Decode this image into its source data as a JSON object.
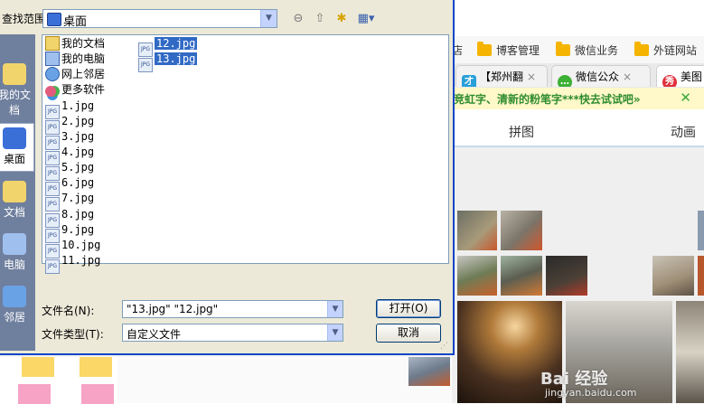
{
  "browser": {
    "bookmarks": [
      {
        "label": "店",
        "icon": "none"
      },
      {
        "label": "博客管理",
        "icon": "folder-icon"
      },
      {
        "label": "微信业务",
        "icon": "folder-icon"
      },
      {
        "label": "外链网站",
        "icon": "folder-icon"
      }
    ],
    "tabs": [
      {
        "label": "【郑州翻",
        "icon": "page-icon",
        "close": "×"
      },
      {
        "label": "微信公众",
        "icon": "wechat-icon",
        "close": "×"
      },
      {
        "label": "美图",
        "icon": "meitu-icon",
        "close": ""
      }
    ],
    "banner": {
      "text": "竞虹字、清新的粉笔字***快去试试吧»",
      "close": "✕"
    },
    "nav": {
      "items": [
        "拼图",
        "动画"
      ]
    },
    "watermark": {
      "brand": "Bai 经验",
      "url": "jingyan.baidu.com"
    }
  },
  "dialog": {
    "lookin": {
      "label": "查找范围(I):",
      "value": "桌面"
    },
    "places": [
      {
        "label": "我的文档",
        "active": false
      },
      {
        "label": "桌面",
        "active": true
      },
      {
        "label": "文档",
        "active": false
      },
      {
        "label": "电脑",
        "active": false
      },
      {
        "label": "邻居",
        "active": false
      }
    ],
    "items_col1": [
      {
        "name": "我的文档",
        "icon": "docs-icon",
        "selected": false
      },
      {
        "name": "我的电脑",
        "icon": "my-computer-icon",
        "selected": false
      },
      {
        "name": "网上邻居",
        "icon": "network-icon",
        "selected": false
      },
      {
        "name": "更多软件",
        "icon": "more-software-icon",
        "selected": false
      },
      {
        "name": "1.jpg",
        "icon": "jpg-file-icon",
        "selected": false
      },
      {
        "name": "2.jpg",
        "icon": "jpg-file-icon",
        "selected": false
      },
      {
        "name": "3.jpg",
        "icon": "jpg-file-icon",
        "selected": false
      },
      {
        "name": "4.jpg",
        "icon": "jpg-file-icon",
        "selected": false
      },
      {
        "name": "5.jpg",
        "icon": "jpg-file-icon",
        "selected": false
      },
      {
        "name": "6.jpg",
        "icon": "jpg-file-icon",
        "selected": false
      },
      {
        "name": "7.jpg",
        "icon": "jpg-file-icon",
        "selected": false
      },
      {
        "name": "8.jpg",
        "icon": "jpg-file-icon",
        "selected": false
      },
      {
        "name": "9.jpg",
        "icon": "jpg-file-icon",
        "selected": false
      },
      {
        "name": "10.jpg",
        "icon": "jpg-file-icon",
        "selected": false
      },
      {
        "name": "11.jpg",
        "icon": "jpg-file-icon",
        "selected": false
      }
    ],
    "items_col2": [
      {
        "name": "12.jpg",
        "icon": "jpg-file-icon",
        "selected": true
      },
      {
        "name": "13.jpg",
        "icon": "jpg-file-icon",
        "selected": true
      }
    ],
    "jpg_badge": "JPG",
    "filename": {
      "label": "文件名(N):",
      "value": "\"13.jpg\" \"12.jpg\""
    },
    "filetype": {
      "label": "文件类型(T):",
      "value": "自定义文件"
    },
    "open_button": "打开(O)",
    "cancel_button": "取消",
    "combo_arrow": "▼"
  },
  "colors": {
    "titlebar_border": "#0a45c8",
    "dialog_bg": "#ece9d8",
    "selection": "#316ac5",
    "places_bar": "#6f7f9e",
    "banner_text": "#2f8d2f"
  }
}
